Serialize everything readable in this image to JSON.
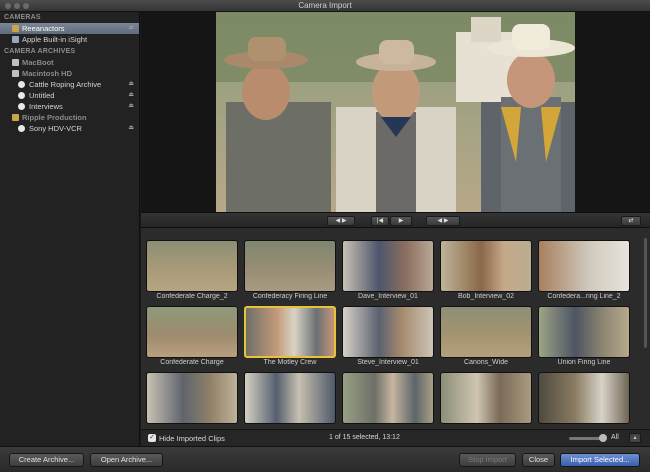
{
  "window": {
    "title": "Camera Import"
  },
  "sidebar": {
    "cameras_header": "CAMERAS",
    "cameras": [
      {
        "label": "Reeanactors",
        "selected": true,
        "eject": "⏏"
      },
      {
        "label": "Apple Built-in iSight"
      }
    ],
    "archives_header": "CAMERA ARCHIVES",
    "archives": [
      {
        "label": "MacBoot",
        "level": 0
      },
      {
        "label": "Macintosh HD",
        "level": 0
      },
      {
        "label": "Cattle Roping Archive",
        "level": 1,
        "eject": "⏏"
      },
      {
        "label": "Untitled",
        "level": 1,
        "eject": "⏏"
      },
      {
        "label": "Interviews",
        "level": 1,
        "eject": "⏏"
      },
      {
        "label": "Ripple Production",
        "level": 0
      },
      {
        "label": "Sony HDV-VCR",
        "level": 1,
        "eject": "⏏"
      }
    ]
  },
  "transport": {
    "buttons": [
      "◀ ▶",
      "|◀",
      "▶",
      "◀ ▶"
    ],
    "loop_icon": "⇄"
  },
  "clips": [
    {
      "name": "Confederate Charge_2"
    },
    {
      "name": "Confederacy Firing Line"
    },
    {
      "name": "Dave_Interview_01"
    },
    {
      "name": "Bob_Interview_02"
    },
    {
      "name": "Confedera...ring Line_2"
    },
    {
      "name": "Confederate Charge"
    },
    {
      "name": "The Motley Crew",
      "selected": true
    },
    {
      "name": "Steve_Interview_01"
    },
    {
      "name": "Canons_Wide"
    },
    {
      "name": "Union Firing Line"
    },
    {
      "name": ""
    },
    {
      "name": ""
    },
    {
      "name": ""
    },
    {
      "name": ""
    },
    {
      "name": ""
    }
  ],
  "status": {
    "hide_imported_label": "Hide Imported Clips",
    "hide_imported_checked": true,
    "selection_info": "1 of 15 selected, 13:12",
    "zoom_label": "All"
  },
  "bottom": {
    "create_archive": "Create Archive...",
    "open_archive": "Open Archive...",
    "stop_import": "Stop Import",
    "close": "Close",
    "import_selected": "Import Selected..."
  },
  "colors": {
    "selection_highlight": "#e8c33a",
    "primary_button": "#4a6dbd",
    "sidebar_selected": "#6e7a8a"
  }
}
